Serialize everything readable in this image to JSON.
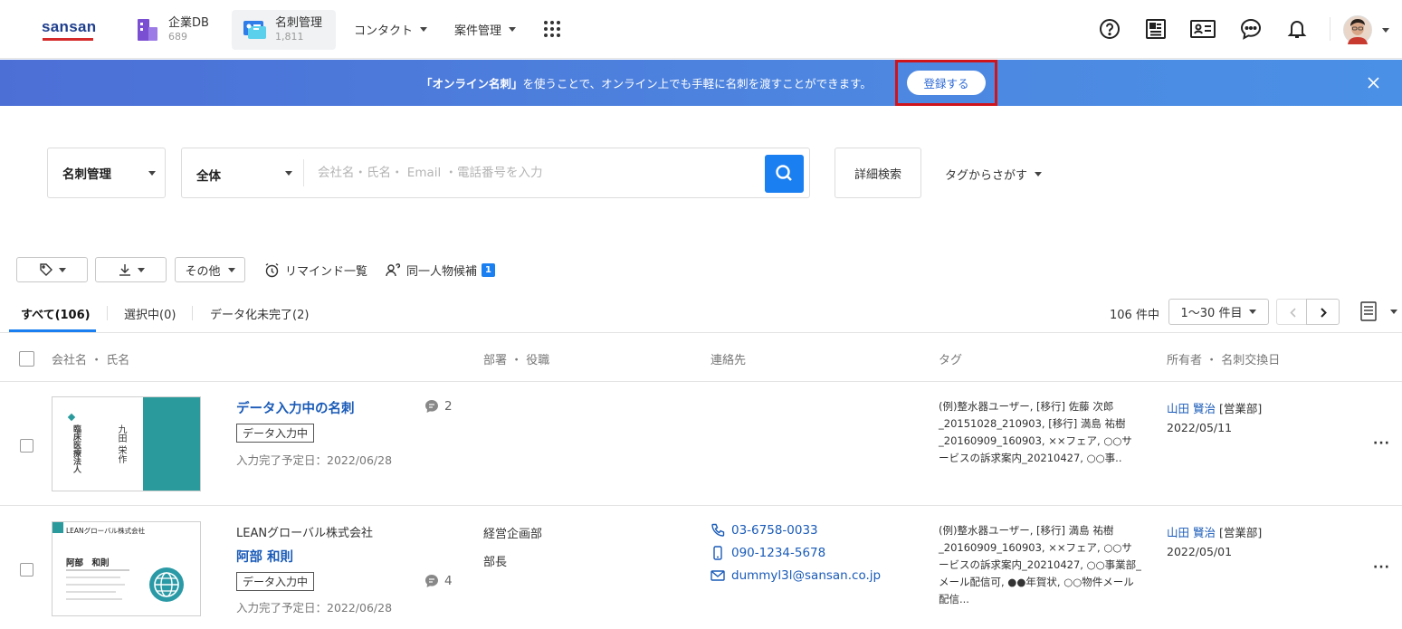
{
  "header": {
    "logo": "sansan",
    "nav": [
      {
        "label": "企業DB",
        "sub": "689"
      },
      {
        "label": "名刺管理",
        "sub": "1,811"
      }
    ],
    "dropdowns": [
      "コンタクト",
      "案件管理"
    ]
  },
  "banner": {
    "highlight": "「オンライン名刺」",
    "text": "を使うことで、オンライン上でも手軽に名刺を渡すことができます。",
    "register": "登録する"
  },
  "search": {
    "category": "名刺管理",
    "scope": "全体",
    "placeholder": "会社名・氏名・ Email ・電話番号を入力",
    "advanced": "詳細検索",
    "tag_search": "タグからさがす"
  },
  "toolbar": {
    "other": "その他",
    "remind": "リマインド一覧",
    "duplicates": "同一人物候補",
    "dup_count": "1"
  },
  "tabs": [
    {
      "label": "すべて(106)"
    },
    {
      "label": "選択中(0)"
    },
    {
      "label": "データ化未完了(2)"
    }
  ],
  "pagination": {
    "count": "106 件中",
    "range": "1〜30 件目"
  },
  "columns": {
    "name": "会社名 ・ 氏名",
    "dept": "部署 ・ 役職",
    "contact": "連絡先",
    "tag": "タグ",
    "owner": "所有者 ・ 名刺交換日"
  },
  "rows": [
    {
      "company": "",
      "name": "データ入力中の名刺",
      "status": "データ入力中",
      "due": "入力完了予定日：2022/06/28",
      "comments": "2",
      "dept": "",
      "title": "",
      "phone": "",
      "mobile": "",
      "email": "",
      "tags": "(例)整水器ユーザー, [移行] 佐藤 次郎_20151028_210903, [移行] 満島 祐樹_20160909_160903, ××フェア, ○○サービスの訴求案内_20210427, ○○事..",
      "owner": "山田 賢治",
      "owner_dept": "[営業部]",
      "date": "2022/05/11",
      "card": {
        "org": "臨床医療法人",
        "name": "九田 栄作"
      }
    },
    {
      "company": "LEANグローバル株式会社",
      "name": "阿部 和則",
      "status": "データ入力中",
      "due": "入力完了予定日：2022/06/28",
      "comments": "4",
      "dept": "経営企画部",
      "title": "部長",
      "phone": "03-6758-0033",
      "mobile": "090-1234-5678",
      "email": "dummyl3l@sansan.co.jp",
      "tags": "(例)整水器ユーザー, [移行] 満島 祐樹_20160909_160903, ××フェア, ○○サービスの訴求案内_20210427, ○○事業部_メール配信可, ●●年賀状, ○○物件メール配信...",
      "owner": "山田 賢治",
      "owner_dept": "[営業部]",
      "date": "2022/05/01",
      "card": {
        "org": "LEANグローバル株式会社",
        "name": "阿部　和則"
      }
    }
  ],
  "colors": {
    "accent": "#1a7ff0",
    "link": "#1a5bb8",
    "banner": "#4d86e0",
    "highlight_box": "#d0141c"
  }
}
